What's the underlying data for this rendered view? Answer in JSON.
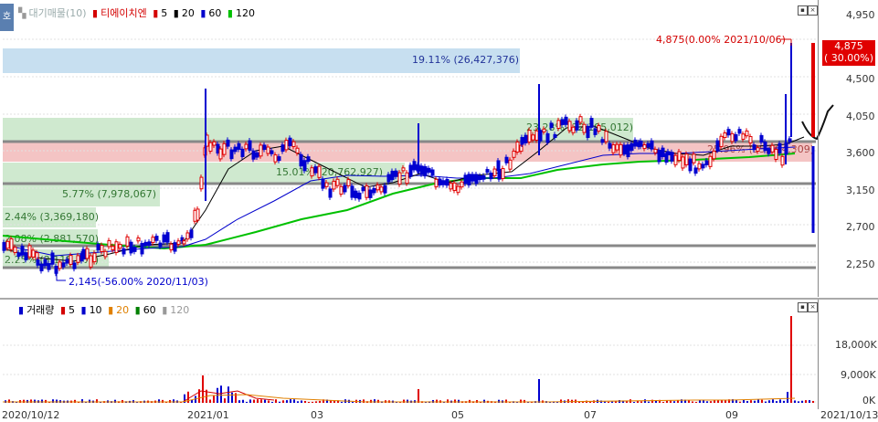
{
  "legend": {
    "toggle_icon": "호",
    "prefix_icon": "bar-icon",
    "band_title": "대기매물(10)",
    "stock_name": "티에이치엔",
    "ma": [
      "5",
      "20",
      "60",
      "120"
    ],
    "ma_colors": [
      "#d40000",
      "#000000",
      "#0000cc",
      "#00c000"
    ]
  },
  "volume_legend": {
    "title": "거래량",
    "ma": [
      "5",
      "10",
      "20",
      "60",
      "120"
    ],
    "ma_colors": [
      "#d40000",
      "#0000cc",
      "#e08000",
      "#008000",
      "#999999"
    ]
  },
  "price_axis": [
    "4,950",
    "4,500",
    "4,050",
    "3,600",
    "3,150",
    "2,700",
    "2,250"
  ],
  "volume_axis": [
    "18,000K",
    "9,000K",
    "0K"
  ],
  "date_axis": [
    "2020/10/12",
    "2021/01",
    "03",
    "05",
    "07",
    "09",
    "2021/10/13"
  ],
  "current_price": {
    "value": "4,875",
    "change": "( 30.00%)"
  },
  "high_marker": "4,875(0.00% 2021/10/06)",
  "low_marker": "2,145(-56.00% 2020/11/03)",
  "volume_bands": [
    {
      "label": "19.11% (26,427,376)",
      "color": "#c7dff0",
      "label_color": "#223399"
    },
    {
      "label": "23.28% (32,195,012)",
      "color": "#cfe9cf",
      "label_color": "#337733"
    },
    {
      "label": "25.96% (35,904,309)",
      "color": "#f4c4c4",
      "label_color": "#aa4444"
    },
    {
      "label": "15.01% (20,762,927)",
      "color": "#cfe9cf",
      "label_color": "#337733"
    },
    {
      "label": "5.77% (7,978,067)",
      "color": "#cfe9cf",
      "label_color": "#337733"
    },
    {
      "label": "2.44% (3,369,180)",
      "color": "#cfe9cf",
      "label_color": "#337733"
    },
    {
      "label": "2.08% (2,881,570)",
      "color": "#cfe9cf",
      "label_color": "#337733"
    },
    {
      "label": "2.25% (3,115,300)",
      "color": "#cfe9cf",
      "label_color": "#337733"
    }
  ],
  "colors": {
    "up": "#e00000",
    "down": "#0000d0",
    "grid": "#d8d8d8"
  }
}
